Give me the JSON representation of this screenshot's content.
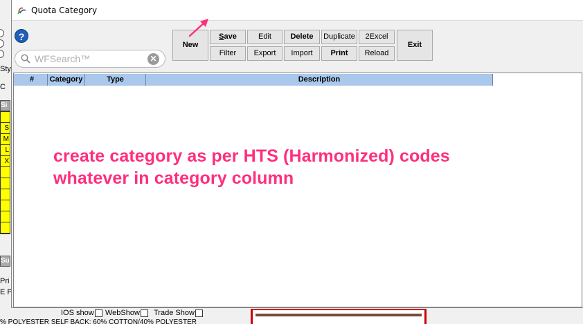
{
  "window": {
    "title": "Quota Category"
  },
  "search": {
    "placeholder": "WFSearch™",
    "value": ""
  },
  "toolbar": {
    "new_label": "New",
    "save_label": "Save",
    "edit_label": "Edit",
    "delete_label": "Delete",
    "duplicate_label": "Duplicate",
    "toexcel_label": "2Excel",
    "exit_label": "Exit",
    "filter_label": "Filter",
    "export_label": "Export",
    "import_label": "Import",
    "print_label": "Print",
    "reload_label": "Reload"
  },
  "grid": {
    "columns": [
      "#",
      "Category",
      "Type",
      "Description"
    ],
    "rows": []
  },
  "annotation": {
    "line1": "create category as per HTS (Harmonized) codes",
    "line2": "whatever in category column",
    "color": "#ff2e7e"
  },
  "background": {
    "styl_text": "Style",
    "ci_text": "C",
    "si_text": "Si",
    "size_cells": [
      "",
      "S",
      "M",
      "L",
      "X",
      "",
      "",
      "",
      "",
      "",
      ""
    ],
    "sum_text": "Sum",
    "pri_text": "Pri",
    "ep_text": "E P",
    "ios_show_label": "IOS show",
    "web_show_label": "WebShow",
    "trade_show_label": "Trade Show",
    "fabric_text": "% POLYESTER SELF BACK: 60% COTTON/40% POLYESTER"
  },
  "icons": {
    "app_icon": "quota-category-app-icon",
    "help_icon": "help-icon",
    "search_icon": "search-icon",
    "clear_icon": "clear-icon",
    "arrow": "annotation-arrow"
  }
}
